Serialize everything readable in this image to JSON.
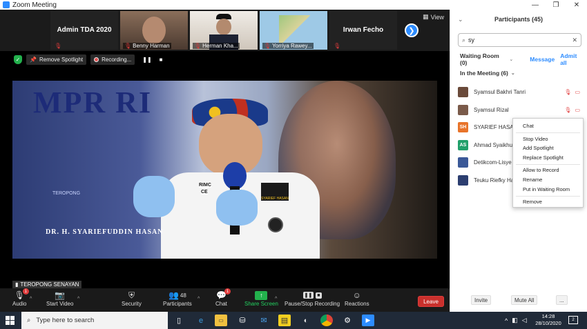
{
  "window": {
    "title": "Zoom Meeting",
    "minimize": "—",
    "maximize": "❐",
    "close": "✕"
  },
  "thumbnails": [
    {
      "name": "Admin TDA 2020",
      "type": "text"
    },
    {
      "name": "Benny Harman",
      "type": "video"
    },
    {
      "name": "Herman Kha...",
      "type": "video"
    },
    {
      "name": "Yorriya Rawey...",
      "type": "map"
    },
    {
      "name": "Irwan Fecho",
      "type": "text"
    }
  ],
  "view_label": "View",
  "meeting_bar": {
    "remove_spotlight": "Remove Spotlight",
    "recording": "Recording..."
  },
  "video": {
    "bg_text": "MPR RI",
    "caption": "DR. H. SYARIEFUDDIN HASAN",
    "logo_text": "TEROPONG",
    "badge_text": "SYARIEF HASAN",
    "shirt_text": "RIMC",
    "shirt_text2": "CE"
  },
  "speaker_name": "TEROPONG SENAYAN",
  "toolbar": {
    "audio": "Audio",
    "audio_badge": "1",
    "start_video": "Start Video",
    "security": "Security",
    "participants": "Participants",
    "participants_count": "48",
    "chat": "Chat",
    "chat_badge": "1",
    "share_screen": "Share Screen",
    "pause_stop": "Pause/Stop Recording",
    "reactions": "Reactions",
    "leave": "Leave"
  },
  "panel": {
    "title": "Participants (45)",
    "search_value": "sy",
    "waiting_room": "Waiting Room (0)",
    "message": "Message",
    "admit_all": "Admit all",
    "in_meeting": "In the Meeting (6)",
    "participants": [
      {
        "name": "Syamsul Bakhri Tanri",
        "avatar": "",
        "color": "#6a4a3a",
        "muted": true
      },
      {
        "name": "Syamsul Rizal",
        "avatar": "",
        "color": "#7a5a4a",
        "muted": true
      },
      {
        "name": "SYARIEF HASAN",
        "avatar": "SH",
        "color": "#e8742a",
        "muted": false
      },
      {
        "name": "Ahmad Syaikhu",
        "avatar": "AS",
        "color": "#22a06b",
        "muted": false
      },
      {
        "name": "Detikcom-Lisye",
        "avatar": "",
        "color": "#3b5998",
        "muted": false
      },
      {
        "name": "Teuku Riefky Ha",
        "avatar": "",
        "color": "#2c3e70",
        "muted": false
      }
    ],
    "invite": "Invite",
    "mute_all": "Mute All",
    "more": "..."
  },
  "context_menu": {
    "items": [
      "Chat",
      "Stop Video",
      "Add Spotlight",
      "Replace Spotlight",
      "Allow to Record",
      "Rename",
      "Put in Waiting Room",
      "Remove"
    ]
  },
  "taskbar": {
    "search_placeholder": "Type here to search",
    "time": "14:28",
    "date": "28/10/2020",
    "notifications": "2"
  }
}
